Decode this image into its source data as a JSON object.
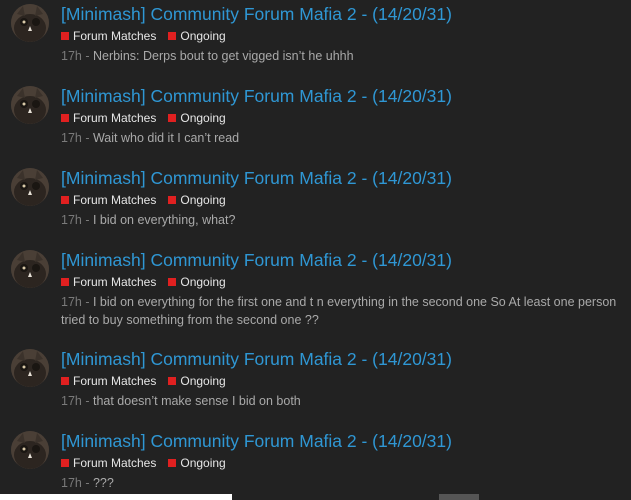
{
  "topics": [
    {
      "title": "[Minimash] Community Forum Mafia 2 - (14/20/31)",
      "category": "Forum Matches",
      "tag": "Ongoing",
      "time": "17h",
      "sep": " - ",
      "excerpt": "Nerbins: Derps bout to get vigged isn’t he uhhh"
    },
    {
      "title": "[Minimash] Community Forum Mafia 2 - (14/20/31)",
      "category": "Forum Matches",
      "tag": "Ongoing",
      "time": "17h",
      "sep": " - ",
      "excerpt": "Wait who did it I can’t read"
    },
    {
      "title": "[Minimash] Community Forum Mafia 2 - (14/20/31)",
      "category": "Forum Matches",
      "tag": "Ongoing",
      "time": "17h",
      "sep": " - ",
      "excerpt": "I bid on everything, what?"
    },
    {
      "title": "[Minimash] Community Forum Mafia 2 - (14/20/31)",
      "category": "Forum Matches",
      "tag": "Ongoing",
      "time": "17h",
      "sep": " - ",
      "excerpt": "I bid on everything for the first one and t n everything in the second one So At least one person tried to buy something from the second one ??"
    },
    {
      "title": "[Minimash] Community Forum Mafia 2 - (14/20/31)",
      "category": "Forum Matches",
      "tag": "Ongoing",
      "time": "17h",
      "sep": " - ",
      "excerpt": "that doesn’t make sense I bid on both"
    },
    {
      "title": "[Minimash] Community Forum Mafia 2 - (14/20/31)",
      "category": "Forum Matches",
      "tag": "Ongoing",
      "time": "17h",
      "sep": " - ",
      "excerpt": "???"
    }
  ],
  "colors": {
    "title": "#2f97d4",
    "category": "#e02020",
    "background": "#222222"
  }
}
